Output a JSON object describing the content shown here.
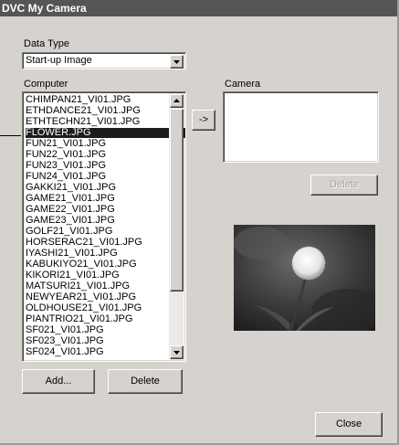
{
  "window": {
    "title": "DVC My Camera"
  },
  "data_type": {
    "label": "Data Type",
    "selected": "Start-up Image"
  },
  "computer": {
    "label": "Computer",
    "files": [
      "CHIMPAN21_VI01.JPG",
      "ETHDANCE21_VI01.JPG",
      "ETHTECHN21_VI01.JPG",
      "FLOWER.JPG",
      "FUN21_VI01.JPG",
      "FUN22_VI01.JPG",
      "FUN23_VI01.JPG",
      "FUN24_VI01.JPG",
      "GAKKI21_VI01.JPG",
      "GAME21_VI01.JPG",
      "GAME22_VI01.JPG",
      "GAME23_VI01.JPG",
      "GOLF21_VI01.JPG",
      "HORSERAC21_VI01.JPG",
      "IYASHI21_VI01.JPG",
      "KABUKIYO21_VI01.JPG",
      "KIKORI21_VI01.JPG",
      "MATSURI21_VI01.JPG",
      "NEWYEAR21_VI01.JPG",
      "OLDHOUSE21_VI01.JPG",
      "PIANTRIO21_VI01.JPG",
      "SF021_VI01.JPG",
      "SF023_VI01.JPG",
      "SF024_VI01.JPG"
    ],
    "selected_index": 3
  },
  "transfer_button": "->",
  "camera": {
    "label": "Camera",
    "delete_label": "Delete"
  },
  "buttons": {
    "add": "Add...",
    "delete": "Delete",
    "close": "Close"
  },
  "icons": {
    "dropdown": "chevron-down-icon",
    "scroll_up": "scroll-up-icon",
    "scroll_down": "scroll-down-icon",
    "preview": "flower-thumbnail"
  }
}
